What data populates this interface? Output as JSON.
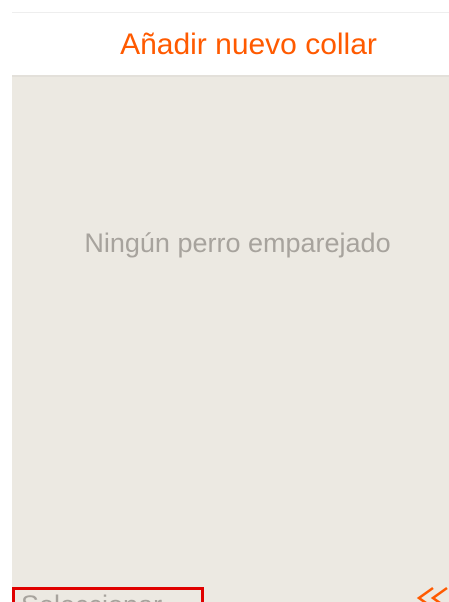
{
  "header": {
    "title": "Añadir nuevo collar"
  },
  "main": {
    "empty_message": "Ningún perro emparejado"
  },
  "footer": {
    "select_label": "Seleccionar",
    "back_icon": "double-chevron-left-icon"
  },
  "colors": {
    "accent": "#ff5a00",
    "background": "#ece9e2",
    "text_muted": "#a7a39d",
    "highlight_border": "#e00000"
  }
}
